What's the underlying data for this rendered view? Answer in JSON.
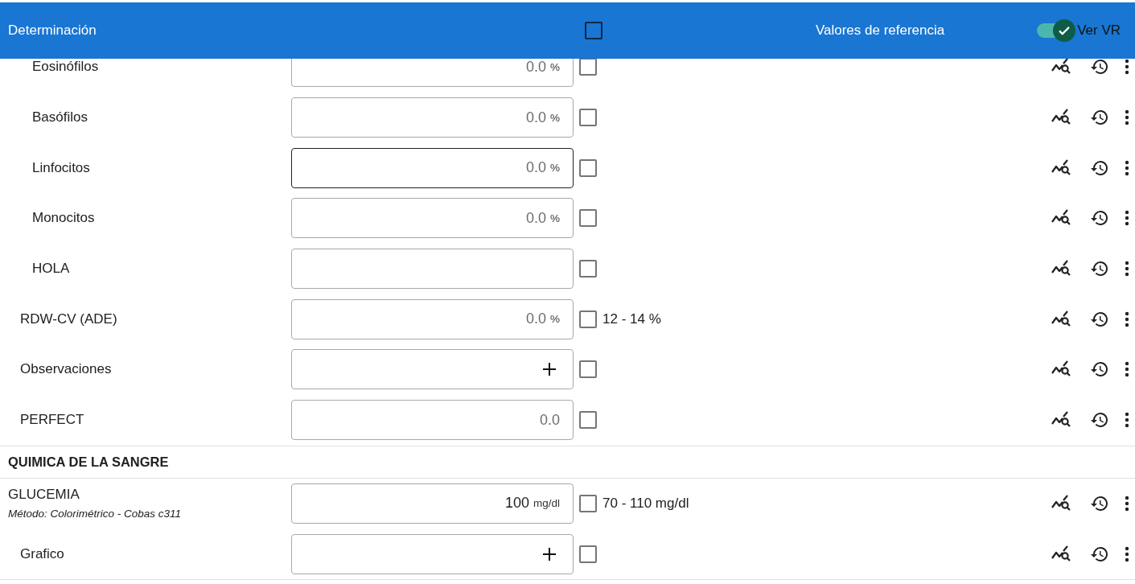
{
  "header": {
    "title": "Determinación",
    "select_all": {
      "checked": false
    },
    "reference_title": "Valores de referencia",
    "show_vr": {
      "label": "Ver VR",
      "on": true
    }
  },
  "sections": [
    {
      "rows": [
        {
          "children": [
            {
              "children": [
                {
                  "name": "Eosinófilos",
                  "kind": "value",
                  "placeholder": "0.0",
                  "unit": "%",
                  "focused": false,
                  "checked": false
                },
                {
                  "name": "Basófilos",
                  "kind": "value",
                  "placeholder": "0.0",
                  "unit": "%",
                  "focused": false,
                  "checked": false
                },
                {
                  "name": "Linfocitos",
                  "kind": "value",
                  "placeholder": "0.0",
                  "unit": "%",
                  "focused": true,
                  "checked": false
                },
                {
                  "name": "Monocitos",
                  "kind": "value",
                  "placeholder": "0.0",
                  "unit": "%",
                  "focused": false,
                  "checked": false
                },
                {
                  "name": "HOLA",
                  "kind": "value",
                  "focused": false,
                  "checked": false
                }
              ]
            },
            {
              "name": "RDW-CV (ADE)",
              "kind": "value",
              "placeholder": "0.0",
              "unit": "%",
              "focused": false,
              "checked": false,
              "reference": "12 - 14 %"
            },
            {
              "name": "Observaciones",
              "kind": "add",
              "focused": false,
              "checked": false
            },
            {
              "name": "PERFECT",
              "kind": "value",
              "placeholder": "0.0",
              "focused": false,
              "checked": false
            }
          ]
        }
      ]
    },
    {
      "title": "QUIMICA DE LA SANGRE",
      "rows": [
        {
          "name": "GLUCEMIA",
          "method": "Método: Colorimétrico - Cobas c311",
          "kind": "value",
          "value": "100",
          "unit": "mg/dl",
          "focused": false,
          "checked": false,
          "reference": "70 - 110 mg/dl",
          "children": [
            {
              "name": "Grafico",
              "kind": "add",
              "focused": false,
              "checked": false
            }
          ]
        }
      ]
    }
  ]
}
